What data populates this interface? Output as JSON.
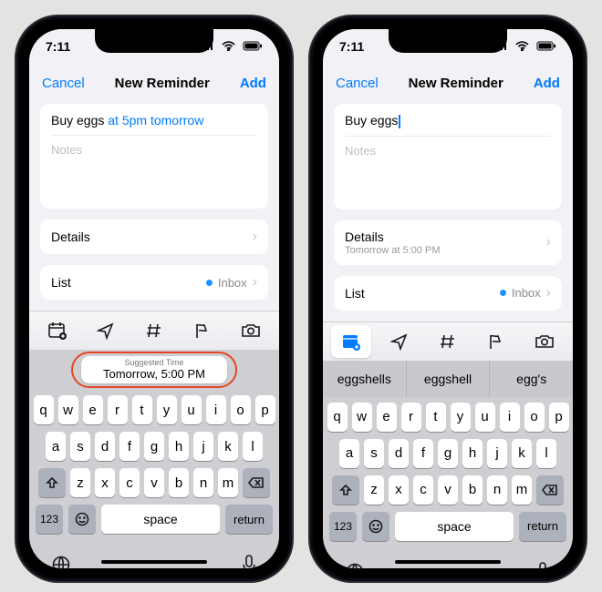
{
  "status": {
    "time": "7:11"
  },
  "nav": {
    "cancel": "Cancel",
    "title": "New Reminder",
    "add": "Add"
  },
  "left": {
    "title_plain": "Buy eggs ",
    "title_parsed": "at 5pm tomorrow",
    "notes_placeholder": "Notes",
    "details_label": "Details",
    "list_label": "List",
    "list_value": "Inbox",
    "suggest_label": "Suggested Time",
    "suggest_value": "Tomorrow, 5:00 PM"
  },
  "right": {
    "title_plain": "Buy eggs",
    "notes_placeholder": "Notes",
    "details_label": "Details",
    "details_sub": "Tomorrow at 5:00 PM",
    "list_label": "List",
    "list_value": "Inbox",
    "predictions": [
      "eggshells",
      "eggshell",
      "egg's"
    ]
  },
  "keyboard": {
    "r1": [
      "q",
      "w",
      "e",
      "r",
      "t",
      "y",
      "u",
      "i",
      "o",
      "p"
    ],
    "r2": [
      "a",
      "s",
      "d",
      "f",
      "g",
      "h",
      "j",
      "k",
      "l"
    ],
    "r3": [
      "z",
      "x",
      "c",
      "v",
      "b",
      "n",
      "m"
    ],
    "num": "123",
    "space": "space",
    "return": "return"
  }
}
